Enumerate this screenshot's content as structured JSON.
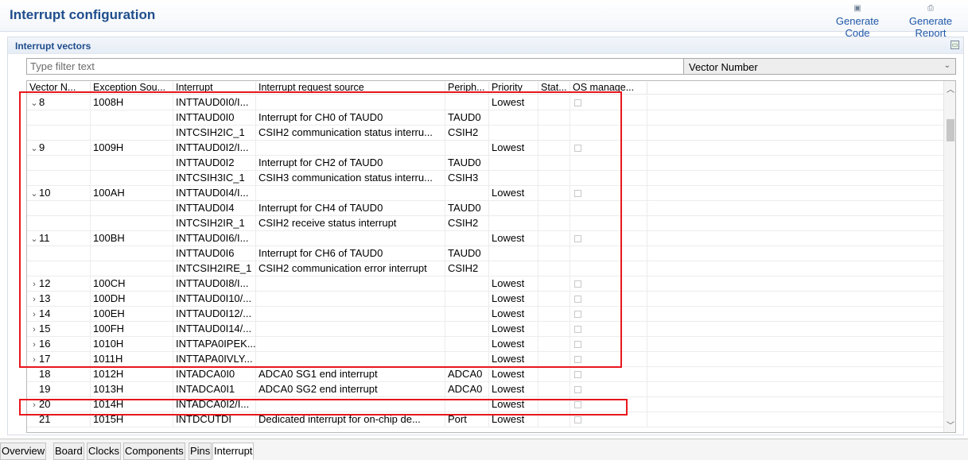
{
  "header": {
    "title": "Interrupt configuration",
    "generate_code": "Generate Code",
    "generate_report": "Generate Report"
  },
  "section": {
    "title": "Interrupt vectors"
  },
  "filter": {
    "placeholder": "Type filter text",
    "value": ""
  },
  "sort": {
    "selected": "Vector Number"
  },
  "columns": [
    "Vector N...",
    "Exception Sou...",
    "Interrupt",
    "Interrupt request source",
    "Periph...",
    "Priority",
    "Stat...",
    "OS manage..."
  ],
  "rows": [
    {
      "twisty": "⌄",
      "vec": "8",
      "exc": "1008H",
      "int": "INTTAUD0I0/I...",
      "src": "",
      "per": "",
      "pri": "Lowest",
      "stat": "",
      "os": true
    },
    {
      "twisty": "",
      "vec": "",
      "exc": "",
      "int": "INTTAUD0I0",
      "src": "Interrupt for CH0 of TAUD0",
      "per": "TAUD0",
      "pri": "",
      "stat": "",
      "os": false
    },
    {
      "twisty": "",
      "vec": "",
      "exc": "",
      "int": "INTCSIH2IC_1",
      "src": "CSIH2 communication status interru...",
      "per": "CSIH2",
      "pri": "",
      "stat": "",
      "os": false
    },
    {
      "twisty": "⌄",
      "vec": "9",
      "exc": "1009H",
      "int": "INTTAUD0I2/I...",
      "src": "",
      "per": "",
      "pri": "Lowest",
      "stat": "",
      "os": true
    },
    {
      "twisty": "",
      "vec": "",
      "exc": "",
      "int": "INTTAUD0I2",
      "src": "Interrupt for CH2 of TAUD0",
      "per": "TAUD0",
      "pri": "",
      "stat": "",
      "os": false
    },
    {
      "twisty": "",
      "vec": "",
      "exc": "",
      "int": "INTCSIH3IC_1",
      "src": "CSIH3 communication status interru...",
      "per": "CSIH3",
      "pri": "",
      "stat": "",
      "os": false
    },
    {
      "twisty": "⌄",
      "vec": "10",
      "exc": "100AH",
      "int": "INTTAUD0I4/I...",
      "src": "",
      "per": "",
      "pri": "Lowest",
      "stat": "",
      "os": true
    },
    {
      "twisty": "",
      "vec": "",
      "exc": "",
      "int": "INTTAUD0I4",
      "src": "Interrupt for CH4 of TAUD0",
      "per": "TAUD0",
      "pri": "",
      "stat": "",
      "os": false
    },
    {
      "twisty": "",
      "vec": "",
      "exc": "",
      "int": "INTCSIH2IR_1",
      "src": "CSIH2 receive status interrupt",
      "per": "CSIH2",
      "pri": "",
      "stat": "",
      "os": false
    },
    {
      "twisty": "⌄",
      "vec": "11",
      "exc": "100BH",
      "int": "INTTAUD0I6/I...",
      "src": "",
      "per": "",
      "pri": "Lowest",
      "stat": "",
      "os": true
    },
    {
      "twisty": "",
      "vec": "",
      "exc": "",
      "int": "INTTAUD0I6",
      "src": "Interrupt for CH6 of TAUD0",
      "per": "TAUD0",
      "pri": "",
      "stat": "",
      "os": false
    },
    {
      "twisty": "",
      "vec": "",
      "exc": "",
      "int": "INTCSIH2IRE_1",
      "src": "CSIH2 communication error interrupt",
      "per": "CSIH2",
      "pri": "",
      "stat": "",
      "os": false
    },
    {
      "twisty": "›",
      "vec": "12",
      "exc": "100CH",
      "int": "INTTAUD0I8/I...",
      "src": "",
      "per": "",
      "pri": "Lowest",
      "stat": "",
      "os": true
    },
    {
      "twisty": "›",
      "vec": "13",
      "exc": "100DH",
      "int": "INTTAUD0I10/...",
      "src": "",
      "per": "",
      "pri": "Lowest",
      "stat": "",
      "os": true
    },
    {
      "twisty": "›",
      "vec": "14",
      "exc": "100EH",
      "int": "INTTAUD0I12/...",
      "src": "",
      "per": "",
      "pri": "Lowest",
      "stat": "",
      "os": true
    },
    {
      "twisty": "›",
      "vec": "15",
      "exc": "100FH",
      "int": "INTTAUD0I14/...",
      "src": "",
      "per": "",
      "pri": "Lowest",
      "stat": "",
      "os": true
    },
    {
      "twisty": "›",
      "vec": "16",
      "exc": "1010H",
      "int": "INTTAPA0IPEK...",
      "src": "",
      "per": "",
      "pri": "Lowest",
      "stat": "",
      "os": true
    },
    {
      "twisty": "›",
      "vec": "17",
      "exc": "1011H",
      "int": "INTTAPA0IVLY...",
      "src": "",
      "per": "",
      "pri": "Lowest",
      "stat": "",
      "os": true
    },
    {
      "twisty": "",
      "vec": "18",
      "exc": "1012H",
      "int": "INTADCA0I0",
      "src": "ADCA0 SG1 end interrupt",
      "per": "ADCA0",
      "pri": "Lowest",
      "stat": "",
      "os": true
    },
    {
      "twisty": "",
      "vec": "19",
      "exc": "1013H",
      "int": "INTADCA0I1",
      "src": "ADCA0 SG2 end interrupt",
      "per": "ADCA0",
      "pri": "Lowest",
      "stat": "",
      "os": true
    },
    {
      "twisty": "›",
      "vec": "20",
      "exc": "1014H",
      "int": "INTADCA0I2/I...",
      "src": "",
      "per": "",
      "pri": "Lowest",
      "stat": "",
      "os": true
    },
    {
      "twisty": "",
      "vec": "21",
      "exc": "1015H",
      "int": "INTDCUTDI",
      "src": "Dedicated interrupt for on-chip de...",
      "per": "Port",
      "pri": "Lowest",
      "stat": "",
      "os": true
    }
  ],
  "bottom_tabs": [
    "Overview",
    "Board",
    "Clocks",
    "Components",
    "Pins",
    "Interrupt"
  ],
  "active_tab": "Interrupt",
  "colors": {
    "title": "#1f4d8c",
    "link": "#1f57a8",
    "highlight_box": "#e8171d"
  }
}
